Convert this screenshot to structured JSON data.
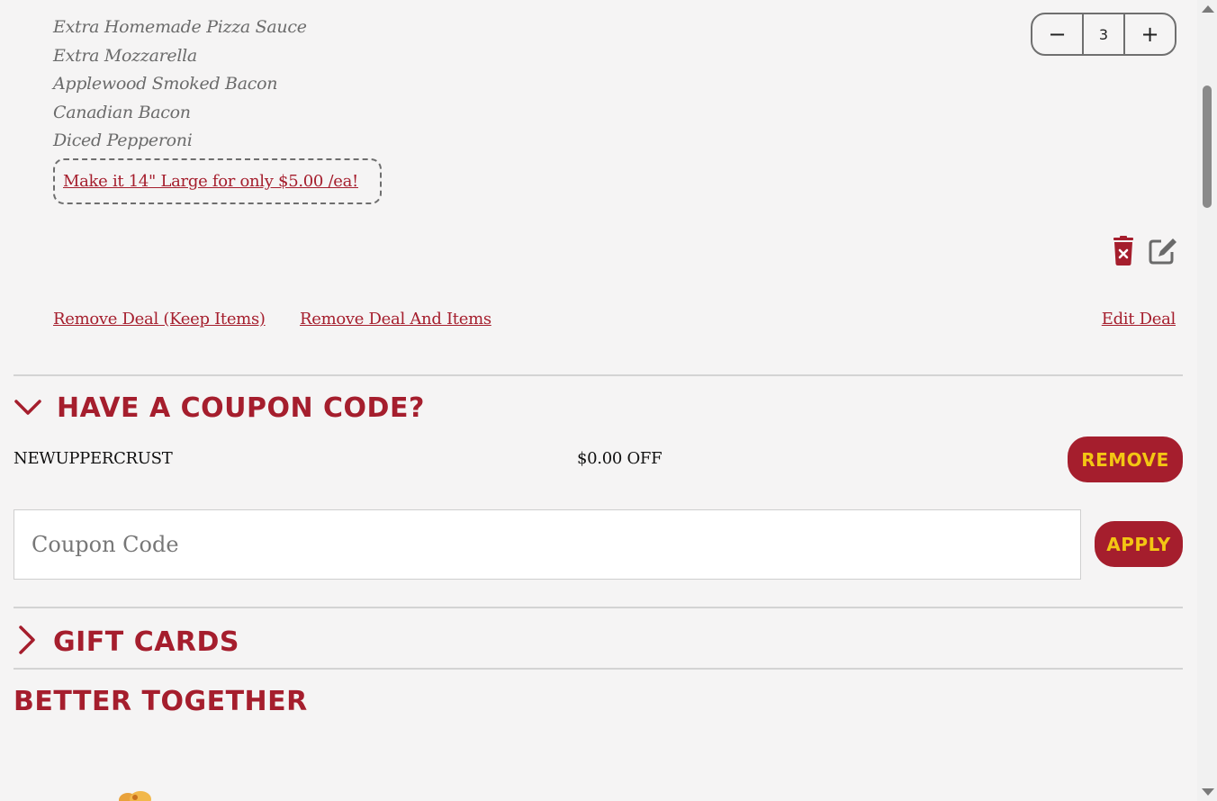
{
  "cart_item": {
    "toppings": [
      "Extra Homemade Pizza Sauce",
      "Extra Mozzarella",
      "Applewood Smoked Bacon",
      "Canadian Bacon",
      "Diced Pepperoni"
    ],
    "upsell_label": "Make it 14\" Large for only $5.00 /ea!",
    "quantity": "3",
    "decrement_label": "−",
    "increment_label": "+"
  },
  "deal_actions": {
    "remove_keep_items": "Remove Deal (Keep Items)",
    "remove_deal_and_items": "Remove Deal And Items",
    "edit_deal": "Edit Deal"
  },
  "coupon_section": {
    "title": "HAVE A COUPON CODE?",
    "applied_code": "NEWUPPERCRUST",
    "applied_discount": "$0.00 OFF",
    "remove_label": "REMOVE",
    "input_placeholder": "Coupon Code",
    "apply_label": "APPLY"
  },
  "gift_cards_section": {
    "title": "GIFT CARDS"
  },
  "better_together_section": {
    "title": "BETTER TOGETHER"
  },
  "colors": {
    "brand_red": "#a51e2d",
    "button_text_yellow": "#f3c613",
    "background": "#f5f4f4"
  }
}
